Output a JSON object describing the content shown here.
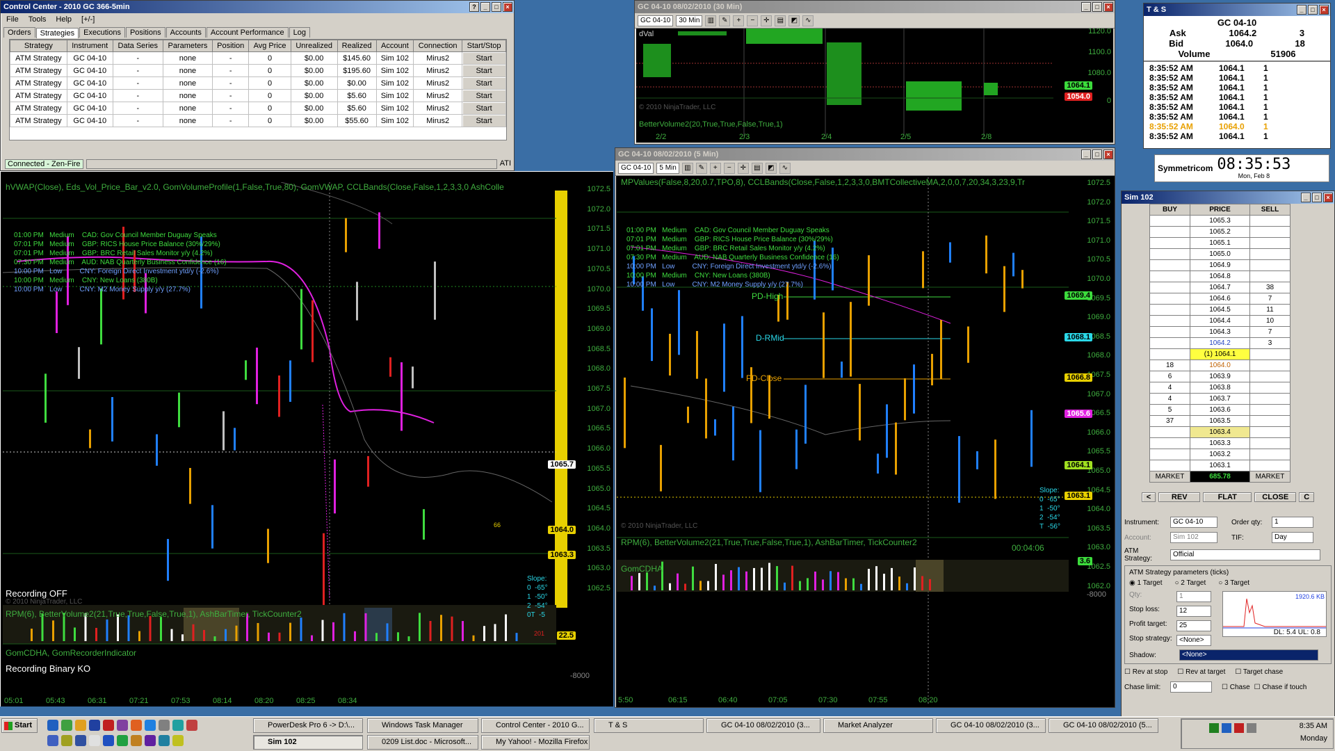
{
  "control_center": {
    "title": "Control Center - 2010 GC 366-5min",
    "menu": [
      "File",
      "Tools",
      "Help",
      "[+/-]"
    ],
    "tabs": [
      "Orders",
      "Strategies",
      "Executions",
      "Positions",
      "Accounts",
      "Account Performance",
      "Log"
    ],
    "columns": [
      "Strategy",
      "Instrument",
      "Data Series",
      "Parameters",
      "Position",
      "Avg Price",
      "Unrealized",
      "Realized",
      "Account",
      "Connection",
      "Start/Stop"
    ],
    "rows": [
      [
        "ATM Strategy",
        "GC 04-10",
        "-",
        "none",
        "-",
        "0",
        "$0.00",
        "$145.60",
        "Sim 102",
        "Mirus2",
        "Start"
      ],
      [
        "ATM Strategy",
        "GC 04-10",
        "-",
        "none",
        "-",
        "0",
        "$0.00",
        "$195.60",
        "Sim 102",
        "Mirus2",
        "Start"
      ],
      [
        "ATM Strategy",
        "GC 04-10",
        "-",
        "none",
        "-",
        "0",
        "$0.00",
        "$0.00",
        "Sim 102",
        "Mirus2",
        "Start"
      ],
      [
        "ATM Strategy",
        "GC 04-10",
        "-",
        "none",
        "-",
        "0",
        "$0.00",
        "$5.60",
        "Sim 102",
        "Mirus2",
        "Start"
      ],
      [
        "ATM Strategy",
        "GC 04-10",
        "-",
        "none",
        "-",
        "0",
        "$0.00",
        "$5.60",
        "Sim 102",
        "Mirus2",
        "Start"
      ],
      [
        "ATM Strategy",
        "GC 04-10",
        "-",
        "none",
        "-",
        "0",
        "$0.00",
        "$55.60",
        "Sim 102",
        "Mirus2",
        "Start"
      ]
    ],
    "status": "Connected - Zen-Fire",
    "status_right": "ATI"
  },
  "chart30": {
    "title": "GC 04-10  08/02/2010 (30 Min)",
    "instrument": "GC 04-10",
    "period": "30 Min",
    "indicator": "BetterVolume2(20,True,True,False,True,1)",
    "copyright": "© 2010 NinjaTrader, LLC",
    "top_label": "dVal",
    "yticks": [
      "1120.0",
      "1100.0",
      "1080.0",
      "1054.0",
      "0"
    ],
    "xticks": [
      "2/2",
      "2/3",
      "2/4",
      "2/5",
      "2/8"
    ],
    "tag1": "1064.1",
    "tag2": "1054.0"
  },
  "chart_left": {
    "indicator": "hVWAP(Close), Eds_Vol_Price_Bar_v2.0, GomVolumeProfile(1,False,True,80), GomVWAP, CCLBands(Close,False,1,2,3,3,0 AshColle",
    "yticks": [
      "1072.5",
      "1072.0",
      "1071.5",
      "1071.0",
      "1070.5",
      "1070.0",
      "1069.5",
      "1069.0",
      "1068.5",
      "1068.0",
      "1067.5",
      "1067.0",
      "1066.5",
      "1066.0",
      "1065.5",
      "1065.0",
      "1064.5",
      "1064.0",
      "1063.5",
      "1063.0",
      "1062.5"
    ],
    "xticks": [
      "05:01",
      "05:43",
      "06:31",
      "07:21",
      "07:53",
      "08:14",
      "08:20",
      "08:25",
      "08:34"
    ],
    "tag_a": "1065.7",
    "tag_b": "1064.0",
    "tag_c": "1063.3",
    "vol_tag": "22.5",
    "bottom_tick": "-8000",
    "recording": "Recording OFF",
    "recording2": "Recording Binary KO",
    "copyright": "© 2010 NinjaTrader, LLC",
    "panel2": "RPM(6), BetterVolume2(21,True,True,False,True,1), AshBarTimer, TickCounter2",
    "panel3": "GomCDHA, GomRecorderIndicator",
    "num66": "66",
    "num201": "201",
    "slope": [
      "Slope:",
      "0  -65°",
      "1  -50°",
      "2  -54°",
      "0T  -5"
    ]
  },
  "chart_right": {
    "title": "GC 04-10  08/02/2010 (5 Min)",
    "instrument": "GC 04-10",
    "period": "5 Min",
    "indicator": "MPValues(False,8,20,0.7,TPO,8), CCLBands(Close,False,1,2,3,3,0,BMTCollectiveMA,2,0,0,7,20,34,3,23,9,Tr",
    "yticks": [
      "1072.5",
      "1072.0",
      "1071.5",
      "1071.0",
      "1070.5",
      "1070.0",
      "1069.5",
      "1069.0",
      "1068.5",
      "1068.0",
      "1067.5",
      "1067.0",
      "1066.5",
      "1066.0",
      "1065.5",
      "1065.0",
      "1064.5",
      "1064.0",
      "1063.5",
      "1063.0",
      "1062.5",
      "1062.0"
    ],
    "xticks": [
      "5:50",
      "06:15",
      "06:40",
      "07:05",
      "07:30",
      "07:55",
      "08:20"
    ],
    "tags": [
      "1069.4",
      "1068.1",
      "1066.8",
      "1065.6",
      "1064.1",
      "1063.1"
    ],
    "vol_tag": "3.6",
    "bottom_tick": "-8000",
    "pd_high": "PD-High",
    "d_rmid": "D-RMid",
    "pd_close": "PD-Close",
    "copyright": "© 2010 NinjaTrader, LLC",
    "panel2": "RPM(6), BetterVolume2(21,True,True,False,True,1), AshBarTimer, TickCounter2",
    "timer": "00:04:06",
    "panel3": "GomCDHA",
    "slope": [
      "Slope:",
      "0  -65°",
      "1  -50°",
      "2  -54°",
      "T  -56°"
    ]
  },
  "news": [
    "01:00 PM   Medium    CAD: Gov Council Member Duguay Speaks",
    "07:01 PM   Medium    GBP: RICS House Price Balance (30%/29%)",
    "07:01 PM   Medium    GBP: BRC Retail Sales Monitor y/y (4.2%)",
    "07:30 PM   Medium    AUD: NAB Quarterly Business Confidence (16)",
    "10:00 PM   Low         CNY: Foreign Direct Investment ytd/y (-2.6%)",
    "10:00 PM   Medium    CNY: New Loans (380B)",
    "10:00 PM   Low         CNY: M2 Money Supply y/y (27.7%)"
  ],
  "ts": {
    "title": "T & S",
    "instrument": "GC 04-10",
    "ask_label": "Ask",
    "ask": "1064.2",
    "ask_size": "3",
    "bid_label": "Bid",
    "bid": "1064.0",
    "bid_size": "18",
    "vol_label": "Volume",
    "volume": "51906",
    "trades": [
      [
        "8:35:52 AM",
        "1064.1",
        "1"
      ],
      [
        "8:35:52 AM",
        "1064.1",
        "1"
      ],
      [
        "8:35:52 AM",
        "1064.1",
        "1"
      ],
      [
        "8:35:52 AM",
        "1064.1",
        "1"
      ],
      [
        "8:35:52 AM",
        "1064.1",
        "1"
      ],
      [
        "8:35:52 AM",
        "1064.1",
        "1"
      ],
      [
        "8:35:52 AM",
        "1064.0",
        "1"
      ],
      [
        "8:35:52 AM",
        "1064.1",
        "1"
      ]
    ]
  },
  "clock": {
    "brand": "Symmetricom",
    "time": "08:35:53",
    "date": "Mon, Feb 8"
  },
  "dom": {
    "title": "Sim 102",
    "headers": [
      "BUY",
      "PRICE",
      "SELL"
    ],
    "rows": [
      [
        "",
        "1065.3",
        ""
      ],
      [
        "",
        "1065.2",
        ""
      ],
      [
        "",
        "1065.1",
        ""
      ],
      [
        "",
        "1065.0",
        ""
      ],
      [
        "",
        "1064.9",
        ""
      ],
      [
        "",
        "1064.8",
        ""
      ],
      [
        "",
        "1064.7",
        "38"
      ],
      [
        "",
        "1064.6",
        "7"
      ],
      [
        "",
        "1064.5",
        "11"
      ],
      [
        "",
        "1064.4",
        "10"
      ],
      [
        "",
        "1064.3",
        "7"
      ],
      [
        "",
        "1064.2",
        "3"
      ],
      [
        "",
        "(1) 1064.1",
        ""
      ],
      [
        "18",
        "1064.0",
        ""
      ],
      [
        "6",
        "1063.9",
        ""
      ],
      [
        "4",
        "1063.8",
        ""
      ],
      [
        "4",
        "1063.7",
        ""
      ],
      [
        "5",
        "1063.6",
        ""
      ],
      [
        "37",
        "1063.5",
        ""
      ],
      [
        "",
        "1063.4",
        ""
      ],
      [
        "",
        "1063.3",
        ""
      ],
      [
        "",
        "1063.2",
        ""
      ],
      [
        "",
        "1063.1",
        ""
      ]
    ],
    "market": "MARKET",
    "pnl": "685.78",
    "buttons": [
      "<",
      "REV",
      "FLAT",
      "CLOSE",
      "C"
    ],
    "instrument_label": "Instrument:",
    "instrument": "GC 04-10",
    "order_qty_label": "Order qty:",
    "order_qty": "1",
    "account_label": "Account:",
    "account": "Sim 102",
    "tif_label": "TIF:",
    "tif": "Day",
    "atm_label": "ATM Strategy:",
    "atm": "Official",
    "params_label": "ATM Strategy parameters (ticks)",
    "targets": [
      "1 Target",
      "2 Target",
      "3 Target"
    ],
    "qty_label": "Qty:",
    "qty": "1",
    "stop_loss_label": "Stop loss:",
    "stop_loss": "12",
    "profit_label": "Profit target:",
    "profit": "25",
    "stop_strategy_label": "Stop strategy:",
    "stop_strategy": "<None>",
    "shadow_label": "Shadow:",
    "shadow": "<None>",
    "rev_stop": "Rev at stop",
    "rev_target": "Rev at target",
    "target_chase": "Target chase",
    "chase_limit_label": "Chase limit:",
    "chase_limit": "0",
    "chase": "Chase",
    "chase_touch": "Chase if touch",
    "graph_label": "1920.6 KB",
    "graph_foot": "DL: 5.4  UL: 0.8"
  },
  "taskbar": {
    "start": "Start",
    "row1": [
      "PowerDesk Pro 6 -> D:\\...",
      "Windows Task Manager",
      "Control Center - 2010 G...",
      "T & S",
      "GC 04-10  08/02/2010 (3...",
      "Market Analyzer",
      "GC 04-10  08/02/2010 (3...",
      "GC 04-10  08/02/2010 (5..."
    ],
    "row2": [
      "Sim 102",
      "0209 List.doc - Microsoft...",
      "My Yahoo! - Mozilla Firefox"
    ],
    "time": "8:35 AM",
    "day": "Monday"
  }
}
